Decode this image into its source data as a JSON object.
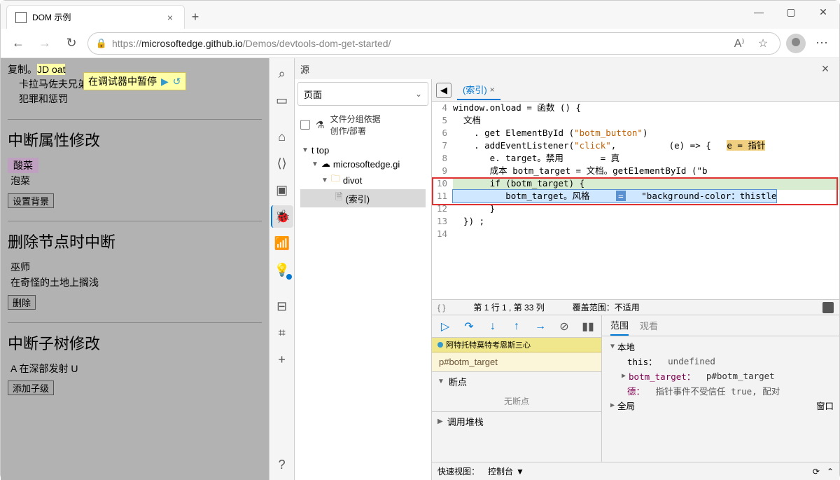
{
  "tab": {
    "title": "DOM 示例"
  },
  "url": {
    "scheme": "https://",
    "host": "microsoftedge.github.io",
    "path": "/Demos/devtools-dom-get-started/"
  },
  "overlay": "在调试器中暂停",
  "page": {
    "line1_a": "复制。",
    "line1_b": "JD oat",
    "line2": "卡拉马佐夫兄弟",
    "line3": "犯罪和惩罚",
    "sec1": {
      "title": "中断属性修改",
      "item1": "酸菜",
      "item2": "泡菜",
      "btn": "设置背景"
    },
    "sec2": {
      "title": "删除节点时中断",
      "item1": "巫师",
      "item2": "在奇怪的土地上搁浅",
      "btn": "删除"
    },
    "sec3": {
      "title": "中断子树修改",
      "item1": "A 在深部发射 U",
      "btn": "添加子级"
    }
  },
  "dt": {
    "title": "源",
    "pageTab": "页面",
    "fileGroup1": "文件分组依据",
    "fileGroup2": "创作/部署",
    "tree": {
      "top": "t top",
      "host": "microsoftedge.gi",
      "folder": "divot",
      "file": "(索引)"
    },
    "fileTab": "(索引)",
    "code": {
      "l4": "window.onload = 函数 () {",
      "l5": "  文档",
      "l6_a": "    . get ElementById (",
      "l6_b": "\"botm_button\"",
      "l6_c": ")",
      "l7_a": "    . addEventListener(",
      "l7_b": "\"click\"",
      "l7_c": ",          (e) => {   ",
      "l7_d": "e = 指针",
      "l8_a": "       e. target。禁用       = 真",
      "l9_a": "       成本 botm_target = 文档。getE1ementById (\"b",
      "l10_a": "       if (botm_target) {",
      "l11_a": "          botm_target。风格     ",
      "l11_eq": "=",
      "l11_b": "   \"background-color：thistle",
      "l12": "       }",
      "l13": "  }) ;",
      "l14": ""
    },
    "status": {
      "pos": "第 1 行 1 , 第 33 列",
      "cov": "覆盖范围：不适用"
    },
    "dbg": {
      "callHdr": "阿特托特莫特考恩斯三心",
      "target": "p#botm_target",
      "bp": "断点",
      "noBp": "无断点",
      "stack": "调用堆栈"
    },
    "scope": {
      "tab1": "范围",
      "tab2": "观看",
      "local": "本地",
      "this": "this：",
      "thisVal": "undefined",
      "bt": "botm_target：",
      "btVal": "p#botm_target",
      "de": "德：",
      "deVal": "指针事件不受信任 true, 配对",
      "global": "全局",
      "window": "窗口"
    },
    "footer": {
      "quick": "快速视图：",
      "console": "控制台"
    }
  }
}
